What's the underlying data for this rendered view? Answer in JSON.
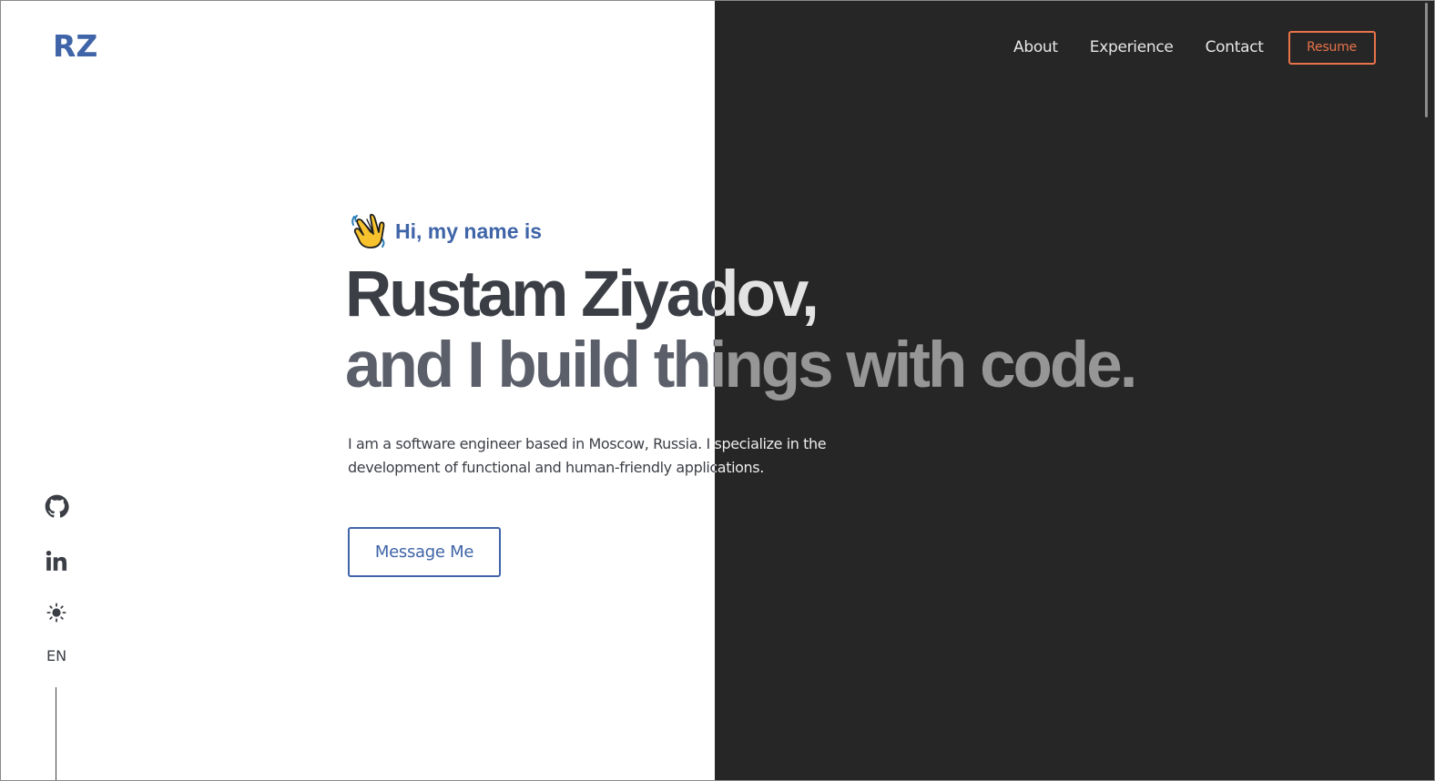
{
  "brand": {
    "logo_text": "RZ",
    "accent_color": "#3f64a8",
    "resume_color": "#e8734a",
    "dark_bg": "#262626"
  },
  "nav": {
    "links": [
      {
        "label": "About"
      },
      {
        "label": "Experience"
      },
      {
        "label": "Contact"
      }
    ],
    "resume_label": "Resume"
  },
  "hero": {
    "greeting_icon": "waving-hand-icon",
    "greeting": "Hi, my name is",
    "name_line": "Rustam Ziyadov,",
    "tagline": "and I build things with code.",
    "intro": "I am a software engineer based in Moscow, Russia. I specialize in the development of functional and human-friendly applications.",
    "cta_label": "Message Me"
  },
  "sidebar": {
    "icons": [
      "github-icon",
      "linkedin-icon",
      "theme-toggle-sun-icon"
    ],
    "language": "EN"
  }
}
